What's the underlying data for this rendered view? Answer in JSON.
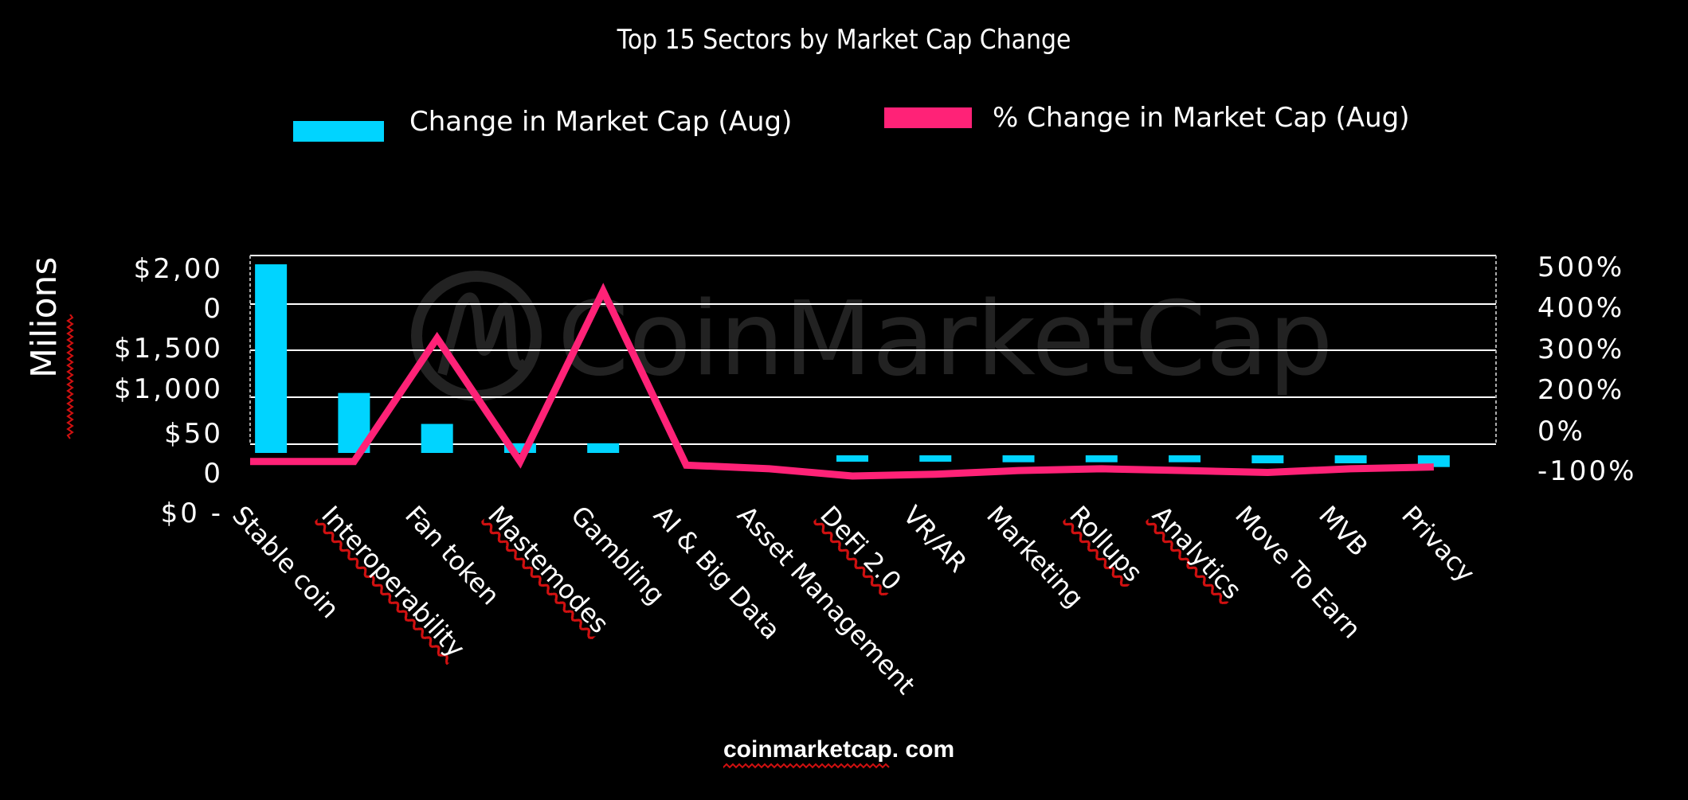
{
  "chart_data": {
    "type": "bar",
    "title": "Top 15 Sectors by Market Cap Change",
    "categories": [
      "Stable  coin",
      "Interoperability",
      "Fan token",
      "Mastemodes",
      "Gambling",
      "AI & Big Data",
      "Asset  Management",
      "DeFi 2.0",
      "VR/AR",
      "Marketing",
      "Rollups",
      "Analytics",
      "Move To Earn",
      "MVB",
      "Privacy"
    ],
    "series": [
      {
        "name": "Change in Market Cap (Aug)",
        "type": "bar",
        "axis": "left",
        "color": "#00d4ff",
        "values": [
          1950,
          620,
          300,
          100,
          100,
          0,
          0,
          -100,
          -100,
          -130,
          -130,
          -130,
          -150,
          -150,
          -220
        ]
      },
      {
        "name": "% Change in Market Cap (Aug)",
        "type": "line",
        "axis": "right",
        "color": "#ff2277",
        "values": [
          -60,
          -60,
          280,
          -60,
          410,
          -70,
          -80,
          -100,
          -95,
          -85,
          -80,
          -85,
          -90,
          -80,
          -75
        ]
      }
    ],
    "ylabel": "Milions",
    "yticks_left": [
      "$2,00\n0",
      "$1,500",
      "$1,000",
      "$50\n0",
      "$0 -"
    ],
    "yticks_right": [
      "500%",
      "400%",
      "300%",
      "200%",
      "0%",
      "-100%"
    ],
    "ylim_left": [
      0,
      2000
    ],
    "ylim_right": [
      -100,
      500
    ],
    "grid": true,
    "legend_position": "top"
  },
  "legend": [
    {
      "label": "Change in Market Cap (Aug)",
      "color": "#00d4ff"
    },
    {
      "label": "% Change in Market Cap (Aug)",
      "color": "#ff2277"
    }
  ],
  "watermark": "CoinMarketCap",
  "footer": "coinmarketcap.   com"
}
